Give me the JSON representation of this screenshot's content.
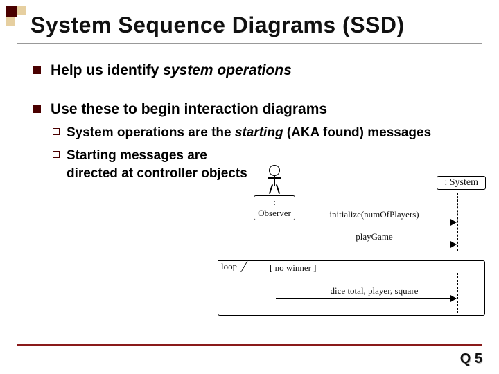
{
  "title": "System Sequence Diagrams (SSD)",
  "bullets": {
    "b1_pre": "Help us identify ",
    "b1_em": "system operations",
    "b2": "Use these to begin interaction diagrams",
    "s1_pre": "System operations are the ",
    "s1_em": "starting",
    "s1_post": " (AKA found) messages",
    "s2": "Starting messages are directed at controller objects"
  },
  "diagram": {
    "actor": ": Observer",
    "system": ": System",
    "msg1": "initialize(numOfPlayers)",
    "msg2": "playGame",
    "msg3": "dice total, player, square",
    "loop": "loop",
    "guard": "[ no winner ]"
  },
  "footer": "Q 5"
}
